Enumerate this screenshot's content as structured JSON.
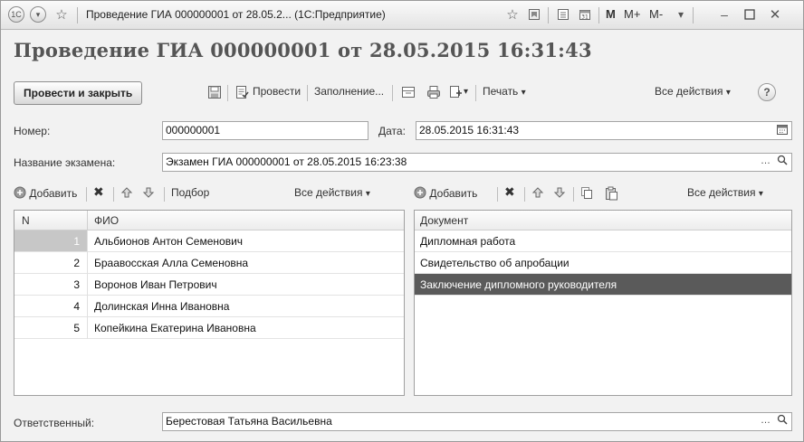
{
  "window": {
    "title": "Проведение ГИА 000000001 от 28.05.2... (1С:Предприятие)",
    "mem_buttons": [
      "M",
      "M+",
      "M-"
    ]
  },
  "header": {
    "title": "Проведение ГИА 000000001 от 28.05.2015 16:31:43"
  },
  "toolbar": {
    "post_and_close": "Провести и закрыть",
    "post": "Провести",
    "fill": "Заполнение...",
    "print": "Печать",
    "all_actions": "Все действия",
    "help": "?"
  },
  "form": {
    "number_label": "Номер:",
    "number_value": "000000001",
    "date_label": "Дата:",
    "date_value": "28.05.2015 16:31:43",
    "exam_label": "Название экзамена:",
    "exam_value": "Экзамен ГИА 000000001 от 28.05.2015 16:23:38",
    "responsible_label": "Ответственный:",
    "responsible_value": "Берестовая Татьяна Васильевна"
  },
  "students_table": {
    "toolbar": {
      "add": "Добавить",
      "pick": "Подбор",
      "all_actions": "Все действия"
    },
    "columns": [
      "N",
      "ФИО"
    ],
    "rows": [
      {
        "n": "1",
        "name": "Альбионов Антон Семенович"
      },
      {
        "n": "2",
        "name": "Браавосская Алла Семеновна"
      },
      {
        "n": "3",
        "name": "Воронов Иван Петрович"
      },
      {
        "n": "4",
        "name": "Долинская Инна Ивановна"
      },
      {
        "n": "5",
        "name": "Копейкина Екатерина Ивановна"
      }
    ]
  },
  "documents_table": {
    "toolbar": {
      "add": "Добавить",
      "all_actions": "Все действия"
    },
    "columns": [
      "Документ"
    ],
    "rows": [
      {
        "doc": "Дипломная работа"
      },
      {
        "doc": "Свидетельство об апробации"
      },
      {
        "doc": "Заключение дипломного руководителя"
      }
    ]
  }
}
